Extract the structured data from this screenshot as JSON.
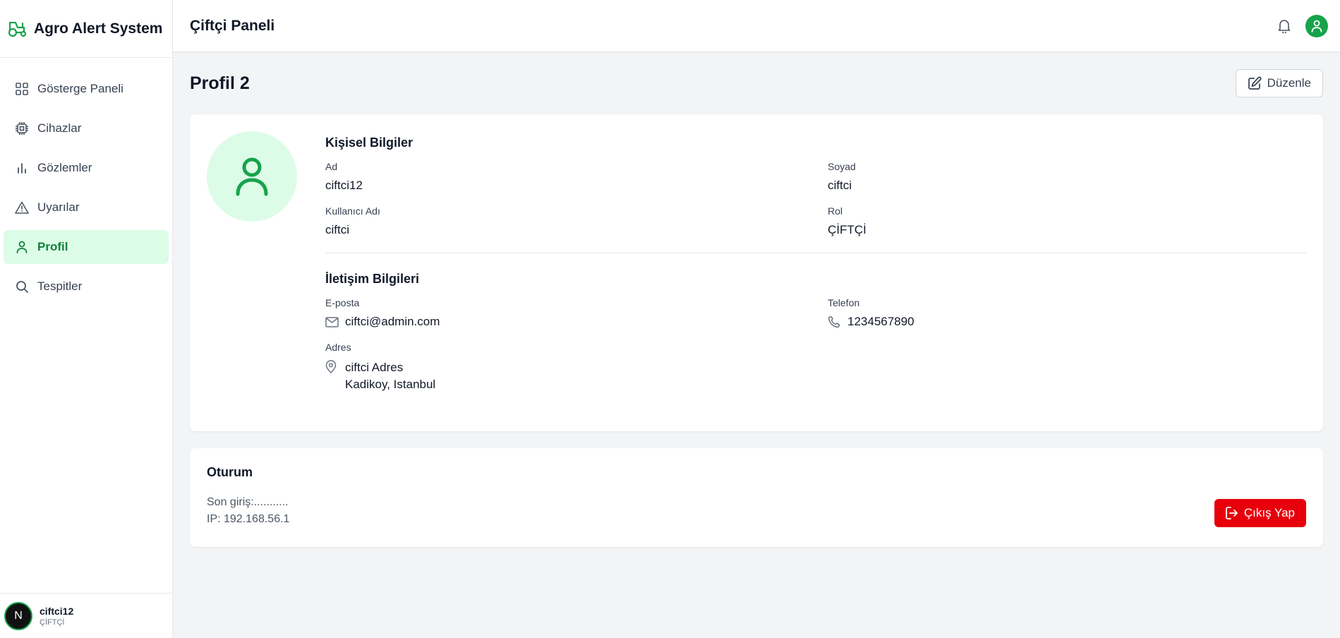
{
  "app": {
    "title": "Agro Alert System",
    "accent": "#16a34a"
  },
  "sidebar": {
    "items": [
      {
        "label": "Gösterge Paneli",
        "icon": "dashboard-grid-icon",
        "active": false
      },
      {
        "label": "Cihazlar",
        "icon": "chip-icon",
        "active": false
      },
      {
        "label": "Gözlemler",
        "icon": "bar-chart-icon",
        "active": false
      },
      {
        "label": "Uyarılar",
        "icon": "warning-triangle-icon",
        "active": false
      },
      {
        "label": "Profil",
        "icon": "user-icon",
        "active": true
      },
      {
        "label": "Tespitler",
        "icon": "search-icon",
        "active": false
      }
    ],
    "footer": {
      "avatar_letter": "N",
      "name": "ciftci12",
      "role": "ÇİFTÇİ"
    }
  },
  "header": {
    "title": "Çiftçi Paneli"
  },
  "page": {
    "title": "Profil 2",
    "edit_label": "Düzenle"
  },
  "personal": {
    "title": "Kişisel Bilgiler",
    "first_name_label": "Ad",
    "first_name": "ciftci12",
    "last_name_label": "Soyad",
    "last_name": "ciftci",
    "username_label": "Kullanıcı Adı",
    "username": "ciftci",
    "role_label": "Rol",
    "role": "ÇİFTÇİ"
  },
  "contact": {
    "title": "İletişim Bilgileri",
    "email_label": "E-posta",
    "email": "ciftci@admin.com",
    "phone_label": "Telefon",
    "phone": "1234567890",
    "address_label": "Adres",
    "address_line1": "ciftci Adres",
    "address_line2": "Kadikoy, Istanbul"
  },
  "session": {
    "title": "Oturum",
    "last_login": "Son giriş:...........",
    "ip": "IP: 192.168.56.1",
    "logout_label": "Çıkış Yap"
  }
}
